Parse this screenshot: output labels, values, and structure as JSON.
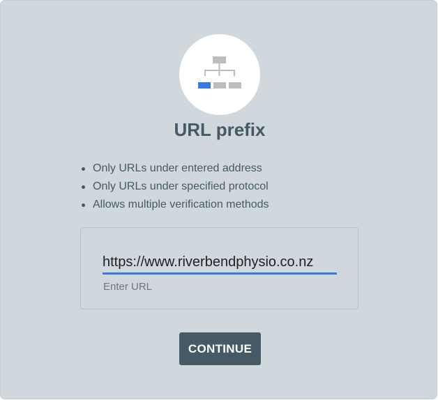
{
  "property_type": {
    "icon": "sitemap-icon",
    "title": "URL prefix",
    "features": [
      "Only URLs under entered address",
      "Only URLs under specified protocol",
      "Allows multiple verification methods"
    ]
  },
  "url_field": {
    "value": "https://www.riverbendphysio.co.nz",
    "label": "Enter URL"
  },
  "actions": {
    "continue_label": "CONTINUE"
  },
  "colors": {
    "card_background": "#d0d8de",
    "title_text": "#455a64",
    "button_background": "#455a64",
    "input_underline": "#3b78e7",
    "icon_highlight": "#3b78e7",
    "icon_gray": "#bdbdbd"
  }
}
